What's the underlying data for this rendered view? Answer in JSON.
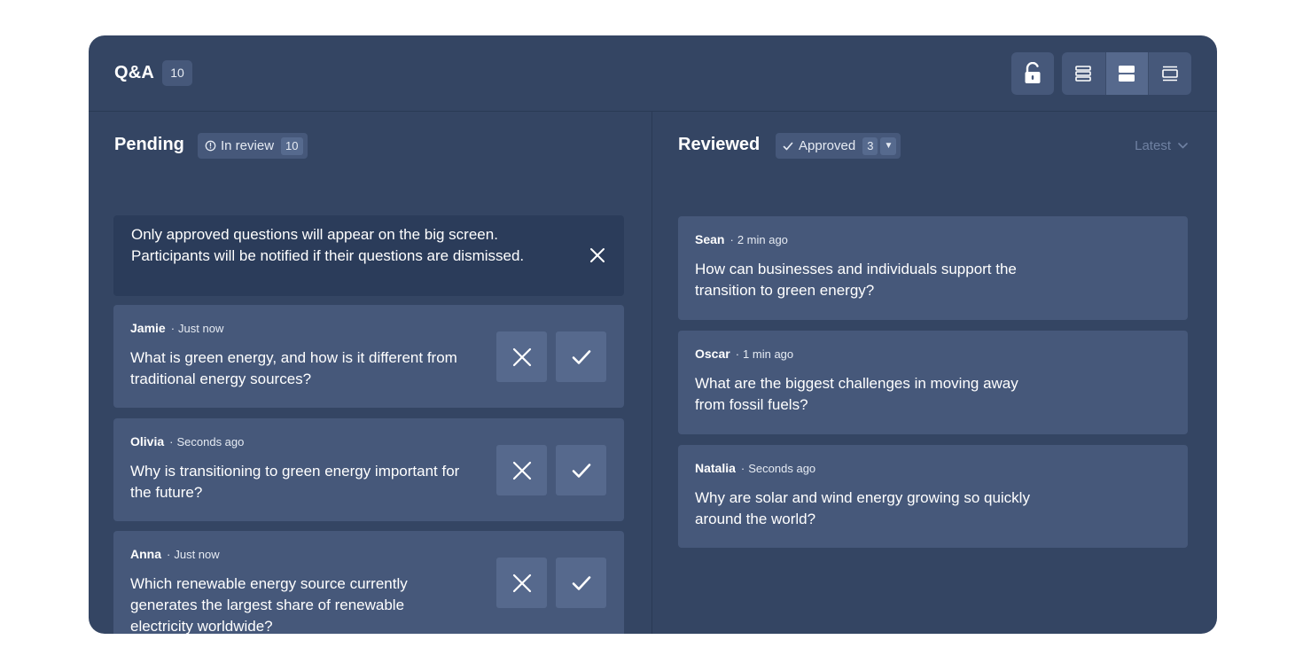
{
  "header": {
    "title": "Q&A",
    "count": "10",
    "lock_icon": "unlock-icon",
    "views": [
      {
        "icon": "list-view-icon",
        "active": false
      },
      {
        "icon": "split-view-icon",
        "active": true
      },
      {
        "icon": "single-view-icon",
        "active": false
      }
    ]
  },
  "pending": {
    "title": "Pending",
    "filter_label": "In review",
    "filter_count": "10",
    "notice": "Only approved questions will appear on the big screen. Participants will be notified if their questions are dismissed.",
    "items": [
      {
        "author": "Jamie",
        "time": "Just now",
        "question": "What is green energy, and how is it different from traditional energy sources?"
      },
      {
        "author": "Olivia",
        "time": "Seconds ago",
        "question": "Why is transitioning to green energy important for the future?"
      },
      {
        "author": "Anna",
        "time": "Just now",
        "question": "Which renewable energy source currently generates the largest share of renewable electricity worldwide?"
      }
    ]
  },
  "reviewed": {
    "title": "Reviewed",
    "filter_label": "Approved",
    "filter_count": "3",
    "sort_label": "Latest",
    "items": [
      {
        "author": "Sean",
        "time": "2 min ago",
        "question": "How can businesses and individuals support the transition to green energy?"
      },
      {
        "author": "Oscar",
        "time": "1 min ago",
        "question": "What are the biggest challenges in moving away from fossil fuels?"
      },
      {
        "author": "Natalia",
        "time": "Seconds ago",
        "question": "Why are solar and wind energy growing so quickly around the world?"
      }
    ]
  },
  "colors": {
    "panel": "#344563",
    "card": "#46587a",
    "notice": "#2b3c5a",
    "button": "#56698d",
    "muted_text": "#6f81a2"
  }
}
